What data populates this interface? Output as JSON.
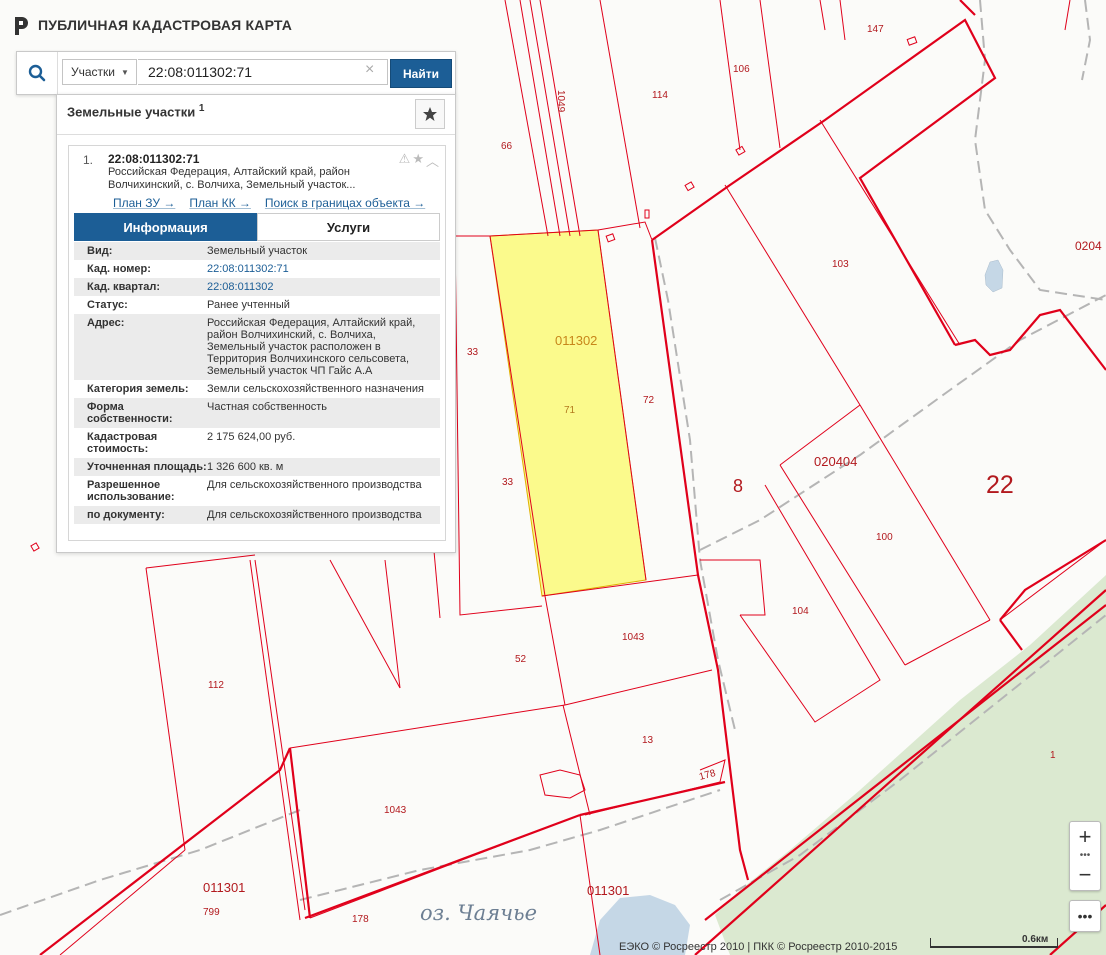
{
  "header": {
    "title": "ПУБЛИЧНАЯ КАДАСТРОВАЯ КАРТА"
  },
  "search": {
    "type_label": "Участки",
    "value": "22:08:011302:71",
    "find_label": "Найти"
  },
  "panel": {
    "title": "Земельные участки",
    "count": "1",
    "result": {
      "number": "1.",
      "cad_number": "22:08:011302:71",
      "address_short": "Российская Федерация, Алтайский край, район Волчихинский, с. Волчиха, Земельный участок...",
      "links": [
        "План ЗУ →",
        "План КК →",
        "Поиск в границах объекта →"
      ],
      "tabs": [
        "Информация",
        "Услуги"
      ],
      "properties": [
        {
          "label": "Вид:",
          "value": "Земельный участок"
        },
        {
          "label": "Кад. номер:",
          "value": "22:08:011302:71"
        },
        {
          "label": "Кад. квартал:",
          "value": "22:08:011302"
        },
        {
          "label": "Статус:",
          "value": "Ранее учтенный"
        },
        {
          "label": "Адрес:",
          "value": "Российская Федерация, Алтайский край, район Волчихинский, с. Волчиха, Земельный участок расположен в Территория Волчихинского сельсовета, Земельный участок ЧП Гайс А.А"
        },
        {
          "label": "Категория земель:",
          "value": "Земли сельскохозяйственного назначения"
        },
        {
          "label": "Форма собственности:",
          "value": "Частная собственность"
        },
        {
          "label": "Кадастровая стоимость:",
          "value": "2 175 624,00 руб."
        },
        {
          "label": "Уточненная площадь:",
          "value": "1 326 600 кв. м"
        },
        {
          "label": "Разрешенное использование:",
          "value": "Для сельскохозяйственного производства"
        },
        {
          "label": "по документу:",
          "value": "Для сельскохозяйственного производства"
        }
      ]
    }
  },
  "map": {
    "labels": {
      "l147": "147",
      "l106": "106",
      "l114": "114",
      "l1049": "1049",
      "l66": "66",
      "l0204a": "0204",
      "l103": "103",
      "l011302": "011302",
      "l71": "71",
      "l72": "72",
      "l33a": "33",
      "l33b": "33",
      "l8": "8",
      "l020404": "020404",
      "l22": "22",
      "l100": "100",
      "l104": "104",
      "l1043a": "1043",
      "l52": "52",
      "l112": "112",
      "l13": "13",
      "l178a": "178",
      "l1043b": "1043",
      "l1": "1",
      "l011301a": "011301",
      "l799": "799",
      "l178b": "178",
      "l011301b": "011301",
      "lake": "оз. Чаячье"
    }
  },
  "attribution": "ЕЭКО © Росреестр 2010 | ПКК © Росреестр 2010-2015",
  "scale": "0.6км",
  "colors": {
    "parcel_line": "#e0001b",
    "highlight": "#fbfa8c",
    "accent": "#1c5e96",
    "forest": "#dbe9d0",
    "water": "#c5d7e6"
  }
}
